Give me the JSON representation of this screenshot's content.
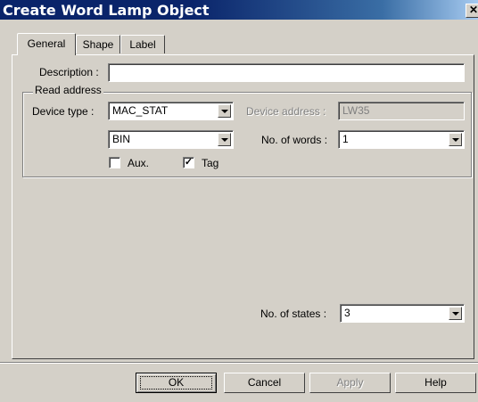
{
  "window": {
    "title": "Create Word Lamp  Object",
    "close_glyph": "✕"
  },
  "tabs": [
    {
      "label": "General",
      "active": true
    },
    {
      "label": "Shape",
      "active": false
    },
    {
      "label": "Label",
      "active": false
    }
  ],
  "general": {
    "description_label": "Description :",
    "description_value": "",
    "read_address_legend": "Read address",
    "device_type_label": "Device type :",
    "device_type_value": "MAC_STAT",
    "device_address_label": "Device address :",
    "device_address_value": "LW35",
    "format_value": "BIN",
    "num_words_label": "No. of words :",
    "num_words_value": "1",
    "aux_label": "Aux.",
    "aux_checked": false,
    "tag_label": "Tag",
    "tag_checked": true,
    "check_mark": "✓",
    "num_states_label": "No. of states :",
    "num_states_value": "3"
  },
  "buttons": {
    "ok": "OK",
    "cancel": "Cancel",
    "apply": "Apply",
    "help": "Help"
  }
}
